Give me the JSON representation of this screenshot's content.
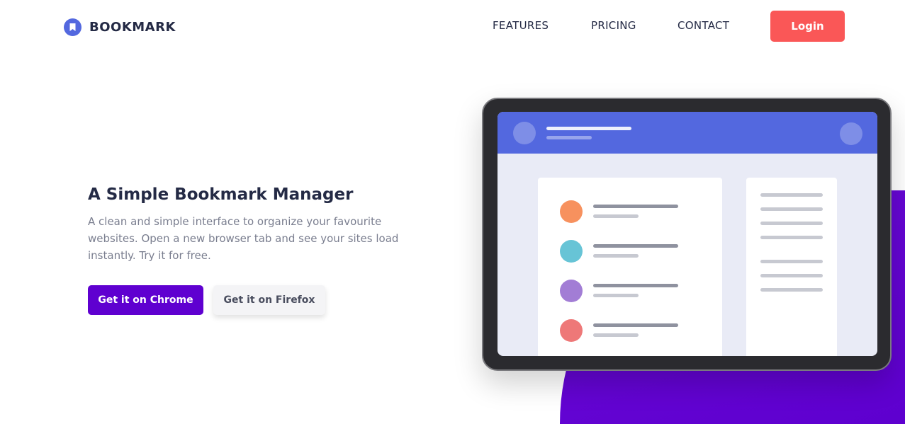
{
  "brand": {
    "name": "BOOKMARK",
    "accent": "#5368df"
  },
  "nav": {
    "items": [
      "FEATURES",
      "PRICING",
      "CONTACT"
    ],
    "login_label": "Login",
    "login_color": "#fa5757"
  },
  "hero": {
    "title": "A Simple Bookmark Manager",
    "description": "A clean and simple interface to organize your favourite websites. Open a new browser tab and see your sites load instantly. Try it for free.",
    "chrome_label": "Get it on Chrome",
    "firefox_label": "Get it on Firefox",
    "primary_color": "#5f00d0"
  },
  "illustration": {
    "list_dot_colors": [
      "#f7915e",
      "#67c4d6",
      "#a27dd5",
      "#ee7878"
    ]
  }
}
